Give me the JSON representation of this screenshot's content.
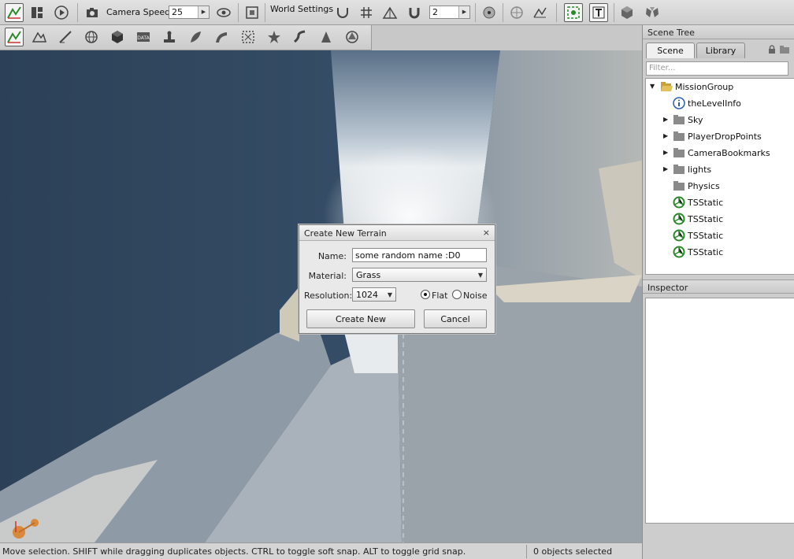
{
  "toolbar": {
    "camera_speed_label": "Camera Speed",
    "camera_speed_value": "25",
    "world_settings_label": "World Settings",
    "grid_size_value": "2"
  },
  "scene_tree": {
    "title": "Scene Tree",
    "tabs": [
      "Scene",
      "Library"
    ],
    "filter_placeholder": "Filter...",
    "items": [
      {
        "label": "MissionGroup",
        "icon": "open-folder-icon",
        "expander": "expanded"
      },
      {
        "label": "theLevelInfo",
        "icon": "info-icon",
        "expander": "none"
      },
      {
        "label": "Sky",
        "icon": "folder-icon",
        "expander": "collapsed"
      },
      {
        "label": "PlayerDropPoints",
        "icon": "folder-icon",
        "expander": "collapsed"
      },
      {
        "label": "CameraBookmarks",
        "icon": "folder-icon",
        "expander": "collapsed"
      },
      {
        "label": "lights",
        "icon": "folder-icon",
        "expander": "collapsed"
      },
      {
        "label": "Physics",
        "icon": "folder-icon",
        "expander": "none"
      },
      {
        "label": "TSStatic",
        "icon": "mesh-icon",
        "expander": "none"
      },
      {
        "label": "TSStatic",
        "icon": "mesh-icon",
        "expander": "none"
      },
      {
        "label": "TSStatic",
        "icon": "mesh-icon",
        "expander": "none"
      },
      {
        "label": "TSStatic",
        "icon": "mesh-icon",
        "expander": "none"
      }
    ]
  },
  "inspector": {
    "title": "Inspector"
  },
  "dialog": {
    "title": "Create New Terrain",
    "close": "×",
    "name_label": "Name:",
    "name_value": "some random name :D0",
    "material_label": "Material:",
    "material_value": "Grass",
    "resolution_label": "Resolution:",
    "resolution_value": "1024",
    "flat_label": "Flat",
    "noise_label": "Noise",
    "selected_mode": "Flat",
    "create_button": "Create New",
    "cancel_button": "Cancel"
  },
  "status": {
    "message": "Move selection.  SHIFT while dragging duplicates objects.  CTRL to toggle soft snap.  ALT to toggle grid snap.",
    "selection": "0 objects selected"
  },
  "colors": {
    "accent_green": "#2a8a2a",
    "info_blue": "#2a5db0",
    "folder": "#8a8a8a"
  }
}
